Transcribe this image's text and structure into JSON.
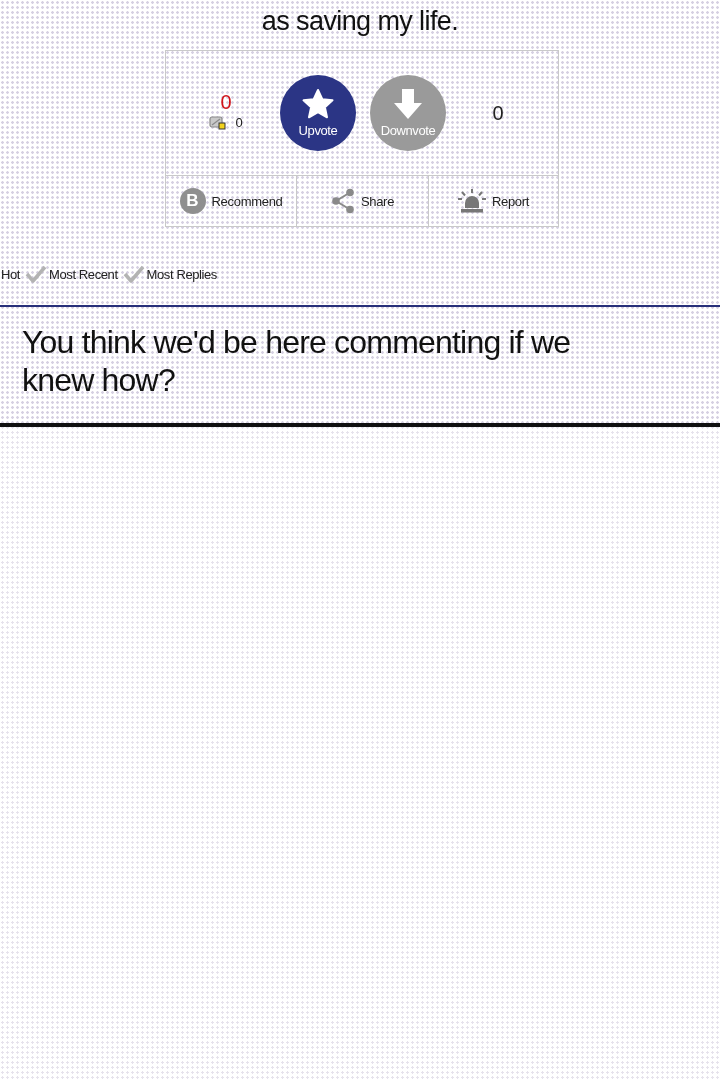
{
  "question": {
    "text": "as saving my life."
  },
  "vote_panel": {
    "score": "0",
    "badge_count": "0",
    "votes": [
      {
        "kind": "up",
        "label": "Upvote"
      },
      {
        "kind": "down",
        "label": "Downvote"
      }
    ],
    "count": "0",
    "actions": [
      {
        "kind": "recommend",
        "label": "Recommend",
        "icon_letter": "B"
      },
      {
        "kind": "share",
        "label": "Share"
      },
      {
        "kind": "report",
        "label": "Report"
      }
    ]
  },
  "sort_options": [
    {
      "label": "Hot",
      "checked": false
    },
    {
      "label": "Most Recent",
      "checked": true
    },
    {
      "label": "Most Replies",
      "checked": true
    }
  ],
  "comment": {
    "text": "You think we'd be here commenting if we knew how?"
  }
}
